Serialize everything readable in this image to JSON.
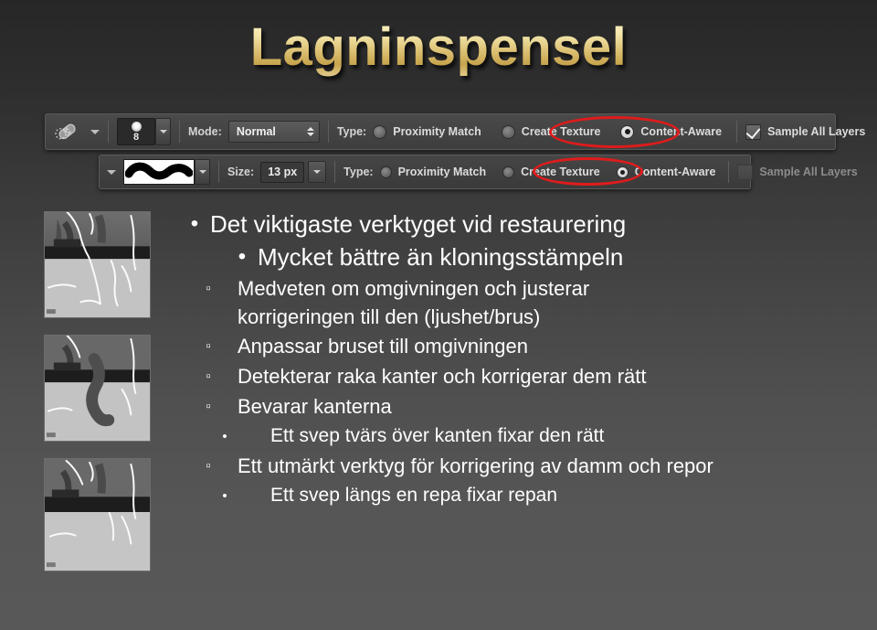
{
  "slide": {
    "title": "Lagninspensel",
    "background_top": "#272727",
    "background_bottom": "#585858",
    "title_gradient_light": "#fdf6cf",
    "title_gradient_dark": "#c7a44d",
    "highlight_color": "#e01b1b"
  },
  "toolbar_1": {
    "tool_icon": "healing-brush-icon",
    "tool_picker_caret": "chevron-down-icon",
    "brush_size_value": "8",
    "brush_preview": "soft-round-brush-tip",
    "brush_stepper_caret": "chevron-down-icon",
    "mode_label": "Mode:",
    "mode_value": "Normal",
    "type_label": "Type:",
    "type_options": [
      {
        "label": "Proximity Match",
        "selected": false
      },
      {
        "label": "Create Texture",
        "selected": false
      },
      {
        "label": "Content-Aware",
        "selected": true
      }
    ],
    "sample_all_layers_label": "Sample All Layers",
    "sample_all_layers_checked": true,
    "sample_all_layers_enabled": true,
    "pressure_icon": "tablet-pressure-icon"
  },
  "toolbar_2": {
    "brush_picker_caret": "chevron-down-icon",
    "brush_stroke_preview": "brush-stroke-preview",
    "stroke_picker_caret": "chevron-down-icon",
    "size_label": "Size:",
    "size_value": "13 px",
    "size_caret": "chevron-down-icon",
    "type_label": "Type:",
    "type_options": [
      {
        "label": "Proximity Match",
        "selected": false
      },
      {
        "label": "Create Texture",
        "selected": false
      },
      {
        "label": "Content-Aware",
        "selected": true
      }
    ],
    "sample_all_layers_label": "Sample All Layers",
    "sample_all_layers_checked": false,
    "sample_all_layers_enabled": false
  },
  "thumbnails": [
    {
      "name": "before-scratched-photo",
      "caption": ""
    },
    {
      "name": "brush-stroke-over-scratch",
      "caption": ""
    },
    {
      "name": "after-healed-photo",
      "caption": ""
    }
  ],
  "bullets": [
    {
      "level": 1,
      "marker": "•",
      "text": "Det viktigaste verktyget vid restaurering",
      "centered": false
    },
    {
      "level": 1,
      "marker": "•",
      "text": "Mycket bättre än kloningsstämpeln",
      "centered": true
    },
    {
      "level": 2,
      "marker": "▫",
      "text": "Medveten om omgivningen och justerar korrigeringen till den (ljushet/brus)",
      "centered": false
    },
    {
      "level": 2,
      "marker": "▫",
      "text": "Anpassar bruset till omgivningen",
      "centered": false
    },
    {
      "level": 2,
      "marker": "▫",
      "text": "Detekterar raka kanter och korrigerar dem rätt",
      "centered": false
    },
    {
      "level": 2,
      "marker": "▫",
      "text": "Bevarar kanterna",
      "centered": false
    },
    {
      "level": 3,
      "marker": "•",
      "text": "Ett svep tvärs över kanten fixar den rätt",
      "centered": false
    },
    {
      "level": 2,
      "marker": "▫",
      "text": "Ett utmärkt verktyg för korrigering av damm och repor",
      "centered": false
    },
    {
      "level": 3,
      "marker": "•",
      "text": "Ett svep längs en repa fixar repan",
      "centered": false
    }
  ]
}
